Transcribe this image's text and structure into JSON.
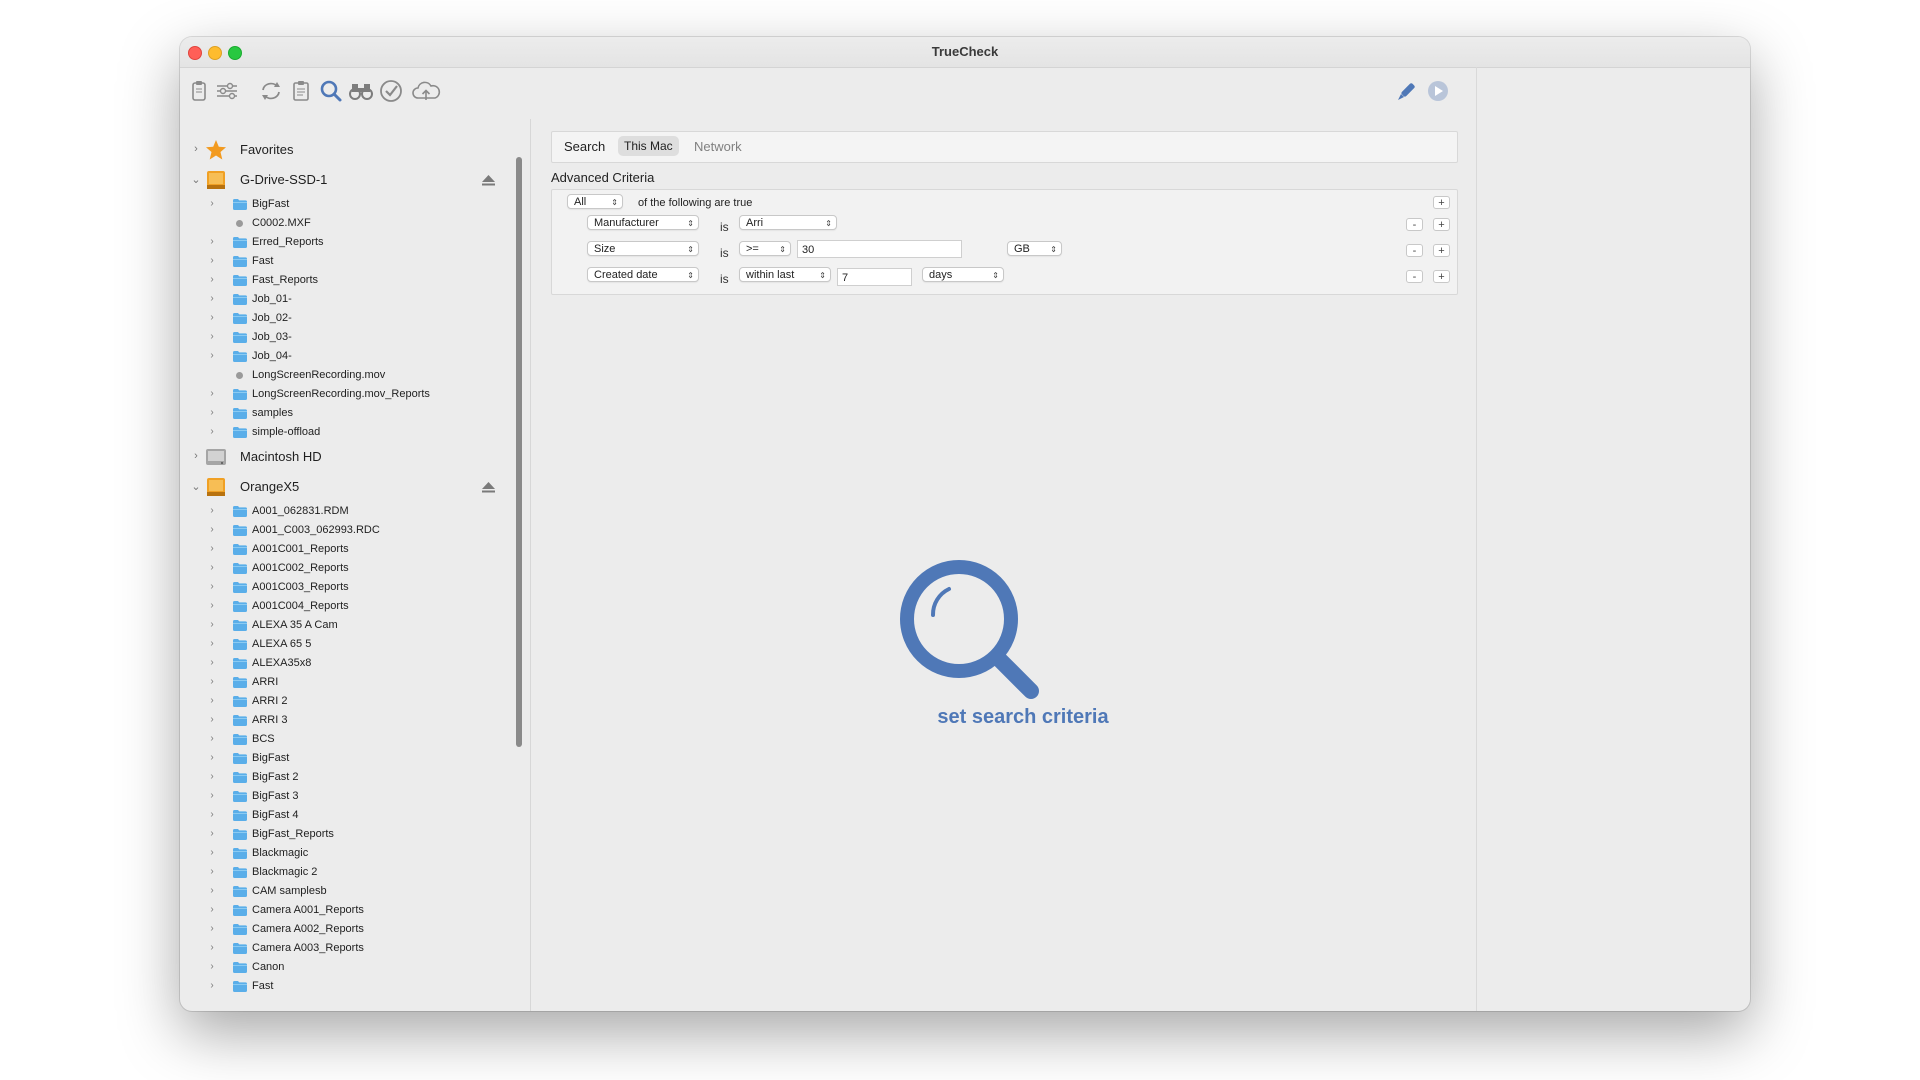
{
  "window": {
    "title": "TrueCheck"
  },
  "toolbar": {
    "left_icons": [
      "clipboard-icon",
      "sliders-icon",
      "sync-icon",
      "report-icon",
      "search-icon",
      "binoculars-icon",
      "checkmark-icon",
      "cloud-upload-icon"
    ],
    "right_icons": [
      "brush-icon",
      "play-icon"
    ]
  },
  "sidebar": {
    "favorites": "Favorites",
    "drives": [
      {
        "name": "G-Drive-SSD-1",
        "items": [
          {
            "label": "BigFast",
            "type": "folder"
          },
          {
            "label": "C0002.MXF",
            "type": "file"
          },
          {
            "label": "Erred_Reports",
            "type": "folder"
          },
          {
            "label": "Fast",
            "type": "folder"
          },
          {
            "label": "Fast_Reports",
            "type": "folder"
          },
          {
            "label": "Job_01-",
            "type": "folder"
          },
          {
            "label": "Job_02-",
            "type": "folder"
          },
          {
            "label": "Job_03-",
            "type": "folder"
          },
          {
            "label": "Job_04-",
            "type": "folder"
          },
          {
            "label": "LongScreenRecording.mov",
            "type": "file"
          },
          {
            "label": "LongScreenRecording.mov_Reports",
            "type": "folder"
          },
          {
            "label": "samples",
            "type": "folder"
          },
          {
            "label": "simple-offload",
            "type": "folder"
          }
        ]
      },
      {
        "name": "Macintosh HD"
      },
      {
        "name": "OrangeX5",
        "items": [
          {
            "label": "A001_062831.RDM",
            "type": "folder"
          },
          {
            "label": "A001_C003_062993.RDC",
            "type": "folder"
          },
          {
            "label": "A001C001_Reports",
            "type": "folder"
          },
          {
            "label": "A001C002_Reports",
            "type": "folder"
          },
          {
            "label": "A001C003_Reports",
            "type": "folder"
          },
          {
            "label": "A001C004_Reports",
            "type": "folder"
          },
          {
            "label": "ALEXA 35 A Cam",
            "type": "folder"
          },
          {
            "label": "ALEXA 65 5",
            "type": "folder"
          },
          {
            "label": "ALEXA35x8",
            "type": "folder"
          },
          {
            "label": "ARRI",
            "type": "folder"
          },
          {
            "label": "ARRI 2",
            "type": "folder"
          },
          {
            "label": "ARRI 3",
            "type": "folder"
          },
          {
            "label": "BCS",
            "type": "folder"
          },
          {
            "label": "BigFast",
            "type": "folder"
          },
          {
            "label": "BigFast 2",
            "type": "folder"
          },
          {
            "label": "BigFast 3",
            "type": "folder"
          },
          {
            "label": "BigFast 4",
            "type": "folder"
          },
          {
            "label": "BigFast_Reports",
            "type": "folder"
          },
          {
            "label": "Blackmagic",
            "type": "folder"
          },
          {
            "label": "Blackmagic 2",
            "type": "folder"
          },
          {
            "label": "CAM samplesb",
            "type": "folder"
          },
          {
            "label": "Camera A001_Reports",
            "type": "folder"
          },
          {
            "label": "Camera A002_Reports",
            "type": "folder"
          },
          {
            "label": "Camera A003_Reports",
            "type": "folder"
          },
          {
            "label": "Canon",
            "type": "folder"
          },
          {
            "label": "Fast",
            "type": "folder"
          }
        ]
      }
    ]
  },
  "search": {
    "scope": {
      "label": "Search",
      "this_mac": "This Mac",
      "network": "Network"
    },
    "advanced_title": "Advanced Criteria",
    "match": {
      "value": "All",
      "suffix": "of the following are true"
    },
    "rules": [
      {
        "field": "Manufacturer",
        "is": "is",
        "operator": "Arri"
      },
      {
        "field": "Size",
        "is": "is",
        "operator": ">=",
        "value": "30",
        "unit": "GB"
      },
      {
        "field": "Created date",
        "is": "is",
        "operator": "within last",
        "value": "7",
        "unit": "days"
      }
    ],
    "add": "+",
    "remove": "-",
    "placeholder_text": "set search criteria"
  },
  "colors": {
    "accent": "#4f78b7",
    "folder": "#5aaee9",
    "drive": "#f0a024",
    "star": "#f29a1f"
  }
}
